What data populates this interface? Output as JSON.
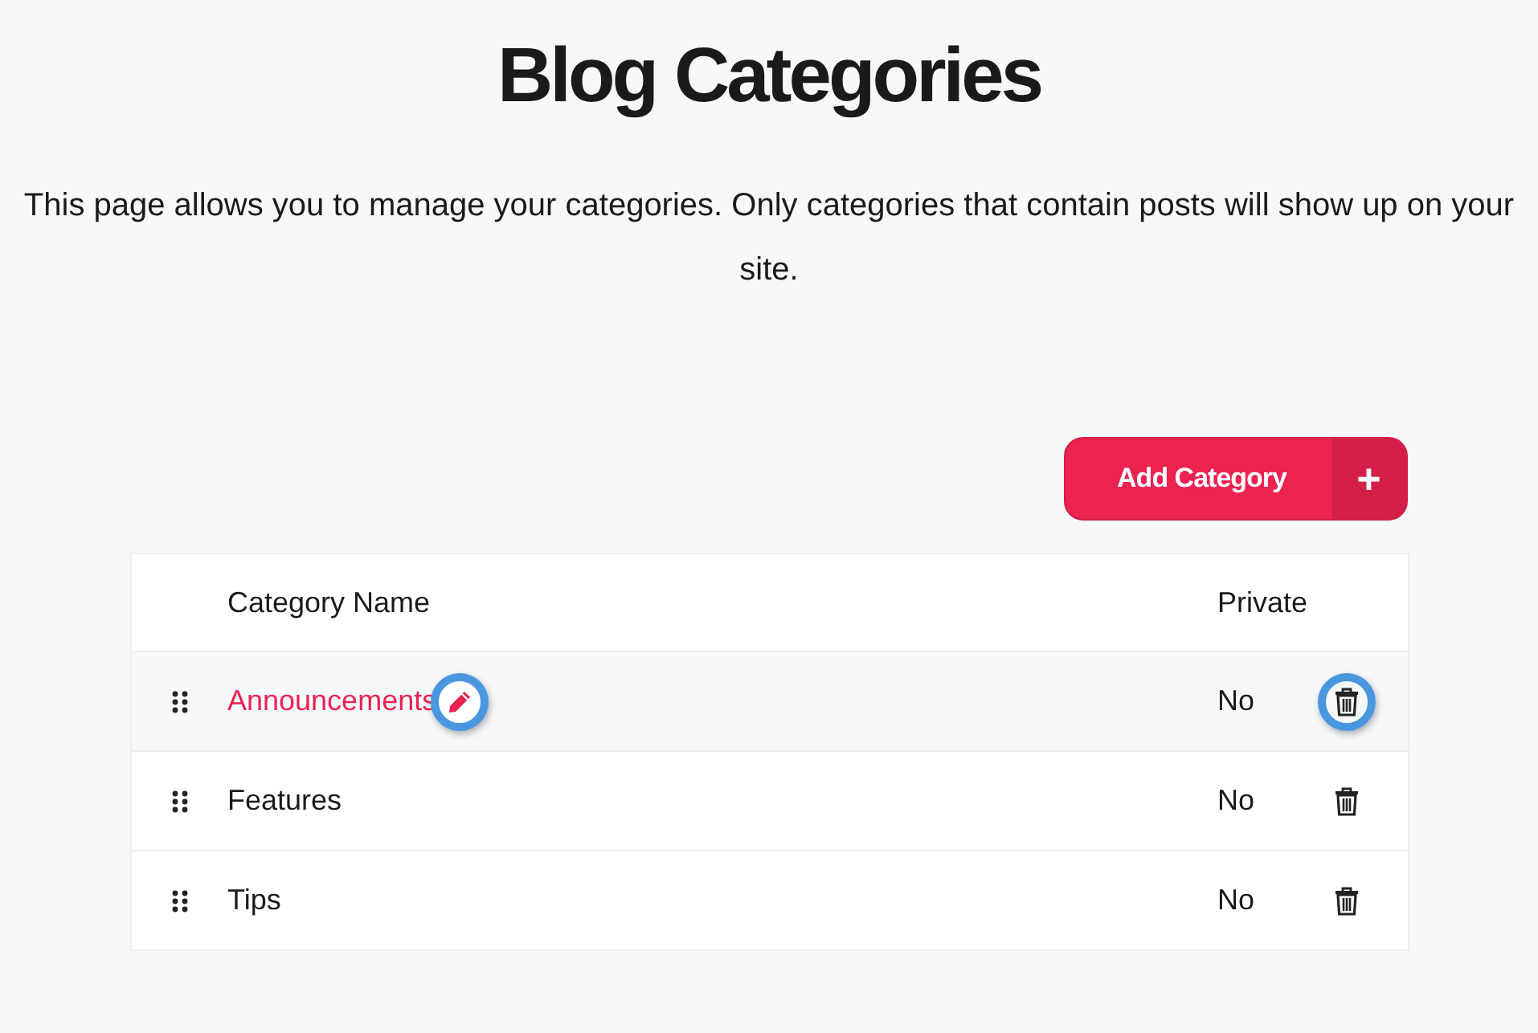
{
  "title": "Blog Categories",
  "description": "This page allows you to manage your categories. Only categories that contain posts will show up on your site.",
  "add_button": {
    "label": "Add Category",
    "icon": "+"
  },
  "table": {
    "columns": [
      "Category Name",
      "Private"
    ],
    "rows": [
      {
        "name": "Announcements",
        "private": "No",
        "highlighted": true
      },
      {
        "name": "Features",
        "private": "No",
        "highlighted": false
      },
      {
        "name": "Tips",
        "private": "No",
        "highlighted": false
      }
    ]
  }
}
